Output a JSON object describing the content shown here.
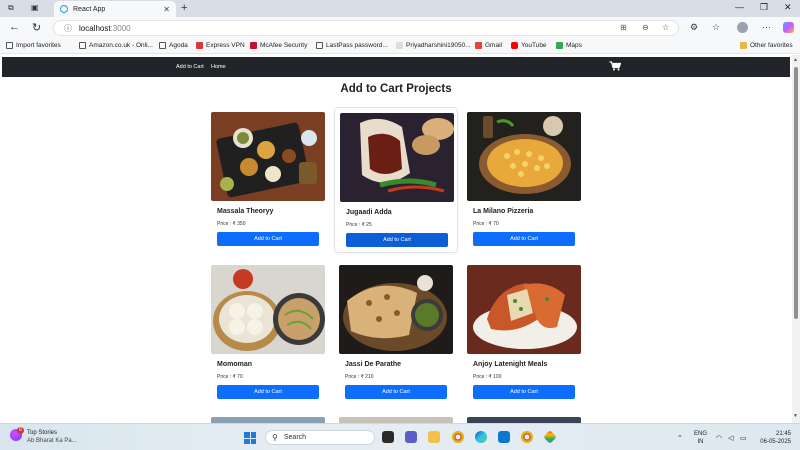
{
  "browser": {
    "tab_title": "React App",
    "tab_close": "✕",
    "new_tab": "+",
    "address": {
      "host": "localhost",
      "port": ":3000"
    },
    "bookmarks": [
      {
        "label": "Import favorites",
        "color": "#555555"
      },
      {
        "label": "Amazon.co.uk - Onli...",
        "color": "#555555"
      },
      {
        "label": "Agoda",
        "color": "#555555"
      },
      {
        "label": "Express VPN",
        "color": "#da3940"
      },
      {
        "label": "McAfee Security",
        "color": "#c8102e"
      },
      {
        "label": "LastPass password...",
        "color": "#555555"
      },
      {
        "label": "Priyadharshini19050...",
        "color": "#dddddd"
      },
      {
        "label": "Gmail",
        "color": "#ea4335"
      },
      {
        "label": "YouTube",
        "color": "#ff0000"
      },
      {
        "label": "Maps",
        "color": "#34a853"
      },
      {
        "label": "Other favorites",
        "color": "#e8b74a"
      }
    ]
  },
  "app": {
    "nav": {
      "add_to_cart": "Add to Cart",
      "home": "Home"
    },
    "heading": "Add to Cart Projects",
    "products": [
      {
        "name": "Massala Theoryy",
        "price": "Price : ₹ 350",
        "button": "Add to Cart"
      },
      {
        "name": "Jugaadi Adda",
        "price": "Price : ₹ 25",
        "button": "Add to Cart"
      },
      {
        "name": "La Milano Pizzeria",
        "price": "Price : ₹ 70",
        "button": "Add to Cart"
      },
      {
        "name": "Momoman",
        "price": "Price : ₹ 70",
        "button": "Add to Cart"
      },
      {
        "name": "Jassi De Parathe",
        "price": "Price : ₹ 210",
        "button": "Add to Cart"
      },
      {
        "name": "Anjoy Latenight Meals",
        "price": "Price : ₹ 100",
        "button": "Add to Cart"
      }
    ]
  },
  "taskbar": {
    "news_title": "Top Stories",
    "news_sub": "Ab Bharat Ka Pa...",
    "news_badge": "6",
    "search_label": "Search",
    "lang_1": "ENG",
    "lang_2": "IN",
    "time": "21:45",
    "date": "06-05-2025"
  }
}
